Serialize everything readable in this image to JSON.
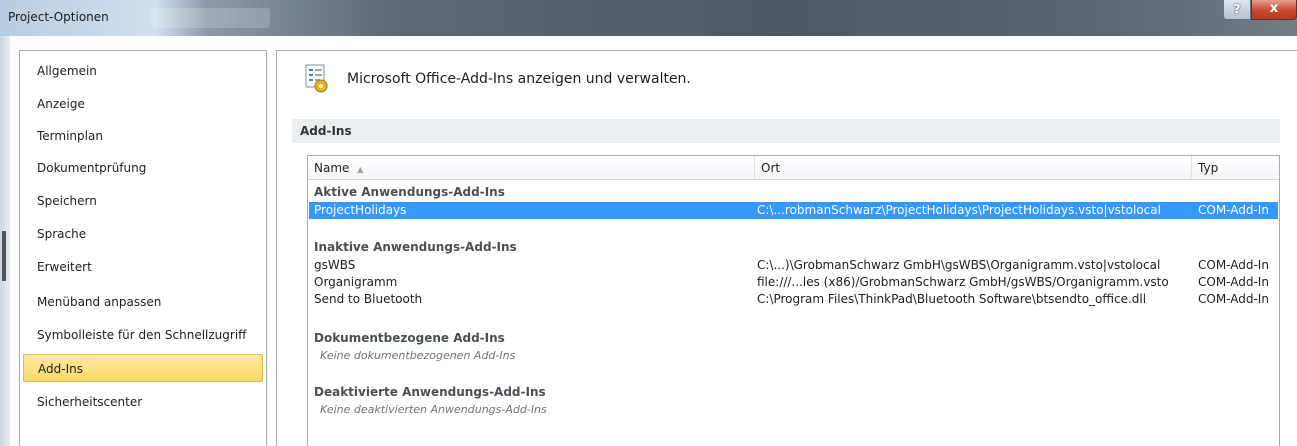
{
  "window": {
    "title": "Project-Optionen",
    "help_label": "?",
    "close_label": "x"
  },
  "sidebar": {
    "items": [
      {
        "label": "Allgemein"
      },
      {
        "label": "Anzeige"
      },
      {
        "label": "Terminplan"
      },
      {
        "label": "Dokumentprüfung"
      },
      {
        "label": "Speichern"
      },
      {
        "label": "Sprache"
      },
      {
        "label": "Erweitert"
      },
      {
        "label": "Menüband anpassen"
      },
      {
        "label": "Symbolleiste für den Schnellzugriff"
      },
      {
        "label": "Add-Ins",
        "active": true
      },
      {
        "label": "Sicherheitscenter"
      }
    ]
  },
  "main": {
    "header_text": "Microsoft Office-Add-Ins anzeigen und verwalten.",
    "section_title": "Add-Ins",
    "columns": {
      "name": "Name",
      "sort_indicator": "▲",
      "ort": "Ort",
      "typ": "Typ"
    },
    "groups": {
      "active": {
        "title": "Aktive Anwendungs-Add-Ins",
        "rows": [
          {
            "name": "ProjectHolidays",
            "ort": "C:\\...robmanSchwarz\\ProjectHolidays\\ProjectHolidays.vsto|vstolocal",
            "typ": "COM-Add-In"
          }
        ]
      },
      "inactive": {
        "title": "Inaktive Anwendungs-Add-Ins",
        "rows": [
          {
            "name": "gsWBS",
            "ort": "C:\\...)\\GrobmanSchwarz GmbH\\gsWBS\\Organigramm.vsto|vstolocal",
            "typ": "COM-Add-In"
          },
          {
            "name": "Organigramm",
            "ort": "file:///...les (x86)/GrobmanSchwarz GmbH/gsWBS/Organigramm.vsto",
            "typ": "COM-Add-In"
          },
          {
            "name": "Send to Bluetooth",
            "ort": "C:\\Program Files\\ThinkPad\\Bluetooth Software\\btsendto_office.dll",
            "typ": "COM-Add-In"
          }
        ]
      },
      "document": {
        "title": "Dokumentbezogene Add-Ins",
        "empty_note": "Keine dokumentbezogenen Add-Ins"
      },
      "disabled": {
        "title": "Deaktivierte Anwendungs-Add-Ins",
        "empty_note": "Keine deaktivierten Anwendungs-Add-Ins"
      }
    }
  },
  "colors": {
    "selection": "#3399ff",
    "active_sidebar": "#fcd96a",
    "section_bar": "#eaedf1"
  }
}
